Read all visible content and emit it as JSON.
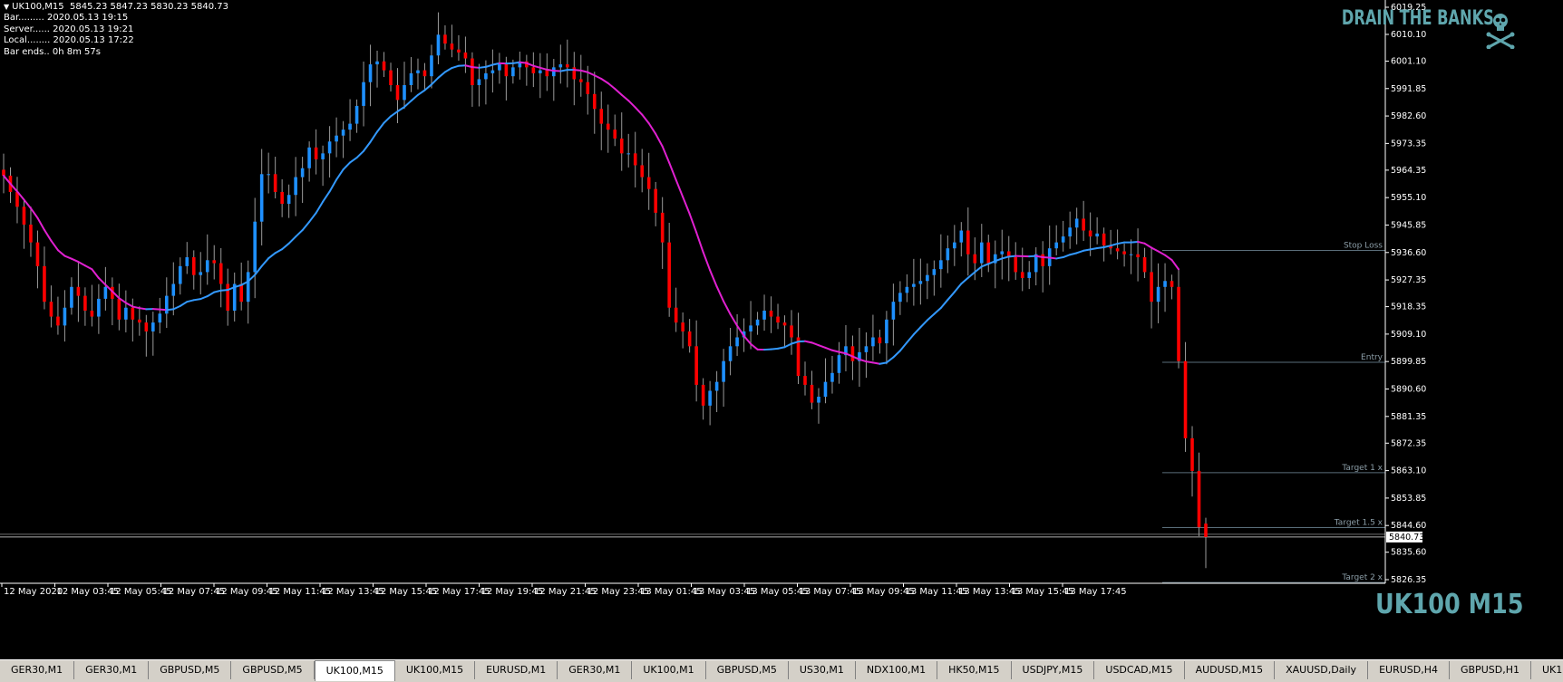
{
  "chart_header": {
    "symbol_line": "UK100,M15  5845.23 5847.23 5830.23 5840.73",
    "bar": "Bar......... 2020.05.13 19:15",
    "server": "Server...... 2020.05.13 19:21",
    "local": "Local........ 2020.05.13 17:22",
    "bar_ends": "Bar ends.. 0h 8m 57s"
  },
  "brand_text": "DRAIN THE BANKS",
  "symbol_watermark": "UK100 M15",
  "current_price": "5840.73",
  "price_axis": [
    "6019.25",
    "6010.10",
    "6001.10",
    "5991.85",
    "5982.60",
    "5973.35",
    "5964.35",
    "5955.10",
    "5945.85",
    "5936.60",
    "5927.35",
    "5918.35",
    "5909.10",
    "5899.85",
    "5890.60",
    "5881.35",
    "5872.35",
    "5863.10",
    "5853.85",
    "5844.60",
    "5835.60",
    "5826.35"
  ],
  "time_axis": [
    "12 May 2020",
    "12 May 03:45",
    "12 May 05:45",
    "12 May 07:45",
    "12 May 09:45",
    "12 May 11:45",
    "12 May 13:45",
    "12 May 15:45",
    "12 May 17:45",
    "12 May 19:45",
    "12 May 21:45",
    "12 May 23:45",
    "13 May 01:45",
    "13 May 03:45",
    "13 May 05:45",
    "13 May 07:45",
    "13 May 09:45",
    "13 May 11:45",
    "13 May 13:45",
    "13 May 15:45",
    "13 May 17:45"
  ],
  "levels": [
    {
      "label": "Stop Loss",
      "price": 5937.3
    },
    {
      "label": "Entry",
      "price": 5899.6
    },
    {
      "label": "Target 1 x",
      "price": 5862.4
    },
    {
      "label": "Target 1.5 x",
      "price": 5843.9
    },
    {
      "label": "Target 2 x",
      "price": 5825.4
    }
  ],
  "tabs": [
    {
      "label": "GER30,M1"
    },
    {
      "label": "GER30,M1"
    },
    {
      "label": "GBPUSD,M5"
    },
    {
      "label": "GBPUSD,M5"
    },
    {
      "label": "UK100,M15",
      "active": true
    },
    {
      "label": "UK100,M15"
    },
    {
      "label": "EURUSD,M1"
    },
    {
      "label": "GER30,M1"
    },
    {
      "label": "UK100,M1"
    },
    {
      "label": "GBPUSD,M5"
    },
    {
      "label": "US30,M1"
    },
    {
      "label": "NDX100,M1"
    },
    {
      "label": "HK50,M15"
    },
    {
      "label": "USDJPY,M15"
    },
    {
      "label": "USDCAD,M15"
    },
    {
      "label": "AUDUSD,M15"
    },
    {
      "label": "XAUUSD,Daily"
    },
    {
      "label": "EURUSD,H4"
    },
    {
      "label": "GBPUSD,H1"
    },
    {
      "label": "UK100,H1"
    },
    {
      "label": "UK10"
    }
  ],
  "colors": {
    "bull": "#1e90ff",
    "bear": "#ff0000",
    "ma_up": "#3399ff",
    "ma_down": "#e020d0",
    "level": "#5a6e7a",
    "background": "#000000",
    "accent": "#5fa6ad"
  },
  "chart_data": {
    "type": "candlestick",
    "symbol": "UK100",
    "timeframe": "M15",
    "ylim": [
      5826.35,
      6019.25
    ],
    "last": {
      "open": 5845.23,
      "high": 5847.23,
      "low": 5830.23,
      "close": 5840.73
    },
    "closes": [
      5962.5,
      5957.0,
      5952.0,
      5946.0,
      5940.0,
      5932.0,
      5920.0,
      5915.0,
      5912.0,
      5918.0,
      5925.0,
      5922.0,
      5917.0,
      5915.0,
      5921.0,
      5925.0,
      5921.0,
      5914.0,
      5918.0,
      5914.0,
      5913.0,
      5910.0,
      5913.0,
      5916.0,
      5922.0,
      5926.0,
      5932.0,
      5935.0,
      5929.0,
      5930.0,
      5934.0,
      5933.0,
      5926.0,
      5917.0,
      5926.0,
      5920.0,
      5930.0,
      5947.0,
      5963.0,
      5963.0,
      5957.0,
      5953.0,
      5956.0,
      5962.0,
      5965.0,
      5972.0,
      5968.0,
      5970.0,
      5974.0,
      5976.0,
      5978.0,
      5980.0,
      5986.0,
      5994.0,
      6000.0,
      6001.0,
      5998.0,
      5993.0,
      5988.0,
      5993.0,
      5997.0,
      5998.0,
      5996.0,
      6003.0,
      6010.0,
      6007.0,
      6005.0,
      6004.0,
      6002.0,
      5993.0,
      5995.0,
      5997.0,
      5998.0,
      6000.0,
      5996.0,
      5999.0,
      6001.0,
      5999.0,
      5997.0,
      5998.0,
      5996.0,
      5999.0,
      6000.0,
      5999.0,
      5995.0,
      5994.0,
      5990.0,
      5985.0,
      5980.0,
      5978.0,
      5975.0,
      5970.0,
      5970.0,
      5966.0,
      5962.0,
      5958.0,
      5950.0,
      5940.0,
      5918.0,
      5913.0,
      5910.0,
      5905.0,
      5892.0,
      5885.0,
      5890.0,
      5893.0,
      5900.0,
      5905.0,
      5908.0,
      5910.0,
      5912.0,
      5914.0,
      5917.0,
      5915.0,
      5913.0,
      5912.0,
      5908.0,
      5895.0,
      5892.0,
      5886.0,
      5888.0,
      5893.0,
      5896.0,
      5902.0,
      5905.0,
      5900.0,
      5903.0,
      5905.0,
      5908.0,
      5906.0,
      5914.0,
      5920.0,
      5923.0,
      5925.0,
      5926.0,
      5927.0,
      5929.0,
      5931.0,
      5934.0,
      5938.0,
      5940.0,
      5944.0,
      5936.0,
      5933.0,
      5940.0,
      5933.0,
      5936.0,
      5937.0,
      5935.0,
      5930.0,
      5928.0,
      5930.0,
      5936.0,
      5932.0,
      5938.0,
      5940.0,
      5942.0,
      5945.0,
      5948.0,
      5944.0,
      5942.0,
      5943.0,
      5939.0,
      5938.0,
      5937.0,
      5936.0,
      5936.0,
      5935.0,
      5930.0,
      5920.0,
      5925.0,
      5927.0,
      5925.0,
      5900.0,
      5874.0,
      5863.0,
      5844.0,
      5840.73
    ]
  }
}
